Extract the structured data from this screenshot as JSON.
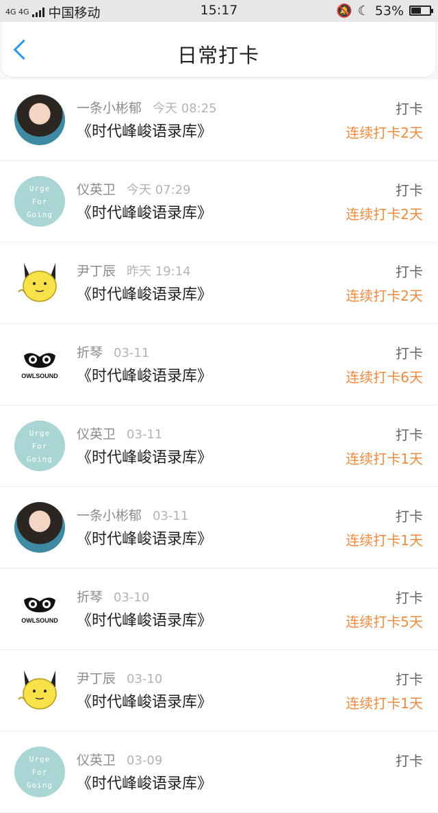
{
  "status_bar": {
    "network": "4G 4G",
    "carrier": "中国移动",
    "time": "15:17",
    "battery": "53%",
    "battery_level": 0.53
  },
  "header": {
    "title": "日常打卡"
  },
  "colors": {
    "accent": "#2a97e6",
    "streak": "#f08a3e",
    "avatar_teal": "#a9d5d5"
  },
  "entries": [
    {
      "user": "一条小彬郁",
      "time": "今天 08:25",
      "book": "《时代峰峻语录库》",
      "action": "打卡",
      "streak": "连续打卡2天",
      "avatar": "photo"
    },
    {
      "user": "仪英卫",
      "time": "今天 07:29",
      "book": "《时代峰峻语录库》",
      "action": "打卡",
      "streak": "连续打卡2天",
      "avatar": "urge"
    },
    {
      "user": "尹丁辰",
      "time": "昨天 19:14",
      "book": "《时代峰峻语录库》",
      "action": "打卡",
      "streak": "连续打卡2天",
      "avatar": "pikachu"
    },
    {
      "user": "折琴",
      "time": "03-11",
      "book": "《时代峰峻语录库》",
      "action": "打卡",
      "streak": "连续打卡6天",
      "avatar": "owl"
    },
    {
      "user": "仪英卫",
      "time": "03-11",
      "book": "《时代峰峻语录库》",
      "action": "打卡",
      "streak": "连续打卡1天",
      "avatar": "urge"
    },
    {
      "user": "一条小彬郁",
      "time": "03-11",
      "book": "《时代峰峻语录库》",
      "action": "打卡",
      "streak": "连续打卡1天",
      "avatar": "photo"
    },
    {
      "user": "折琴",
      "time": "03-10",
      "book": "《时代峰峻语录库》",
      "action": "打卡",
      "streak": "连续打卡5天",
      "avatar": "owl"
    },
    {
      "user": "尹丁辰",
      "time": "03-10",
      "book": "《时代峰峻语录库》",
      "action": "打卡",
      "streak": "连续打卡1天",
      "avatar": "pikachu"
    },
    {
      "user": "仪英卫",
      "time": "03-09",
      "book": "《时代峰峻语录库》",
      "action": "打卡",
      "streak": "",
      "avatar": "urge"
    }
  ],
  "avatar_texts": {
    "urge": [
      "Urge",
      "For",
      "Going"
    ],
    "owl": "OWLSOUND"
  }
}
